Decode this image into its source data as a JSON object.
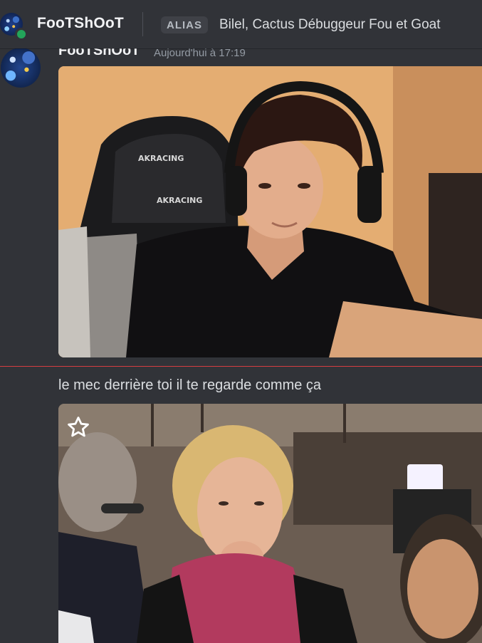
{
  "header": {
    "name": "FooTShOoT",
    "alias_badge": "ALIAS",
    "alias_text": "Bilel, Cactus Débuggeur Fou et Goat"
  },
  "messages": [
    {
      "author": "FooTShOoT",
      "timestamp": "Aujourd'hui à 17:19"
    },
    {
      "text": "le mec derrière toi il te regarde comme ça"
    }
  ],
  "colors": {
    "background": "#313338",
    "status_online": "#23a55a",
    "new_messages_line": "#f23f43"
  },
  "icons": {
    "favorite": "star-outline-icon"
  }
}
